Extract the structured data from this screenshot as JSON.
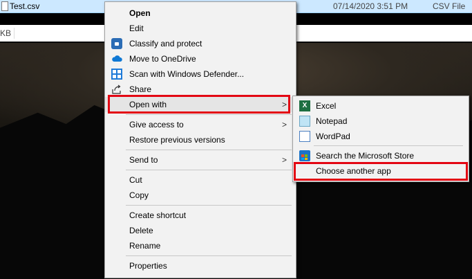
{
  "explorer": {
    "file_name": "Test.csv",
    "file_date": "07/14/2020 3:51 PM",
    "file_type": "CSV File",
    "row2_fragment": "KB"
  },
  "context_menu": {
    "items": [
      {
        "label": "Open"
      },
      {
        "label": "Edit"
      },
      {
        "label": "Classify and protect",
        "icon": "lock-icon"
      },
      {
        "label": "Move to OneDrive",
        "icon": "onedrive-icon"
      },
      {
        "label": "Scan with Windows Defender...",
        "icon": "defender-icon"
      },
      {
        "label": "Share",
        "icon": "share-icon"
      },
      {
        "label": "Open with",
        "submenu": true
      },
      {
        "label": "Give access to",
        "submenu": true
      },
      {
        "label": "Restore previous versions"
      },
      {
        "label": "Send to",
        "submenu": true
      },
      {
        "label": "Cut"
      },
      {
        "label": "Copy"
      },
      {
        "label": "Create shortcut"
      },
      {
        "label": "Delete"
      },
      {
        "label": "Rename"
      },
      {
        "label": "Properties"
      }
    ]
  },
  "open_with_submenu": {
    "items": [
      {
        "label": "Excel",
        "icon": "excel-icon"
      },
      {
        "label": "Notepad",
        "icon": "notepad-icon"
      },
      {
        "label": "WordPad",
        "icon": "wordpad-icon"
      },
      {
        "label": "Search the Microsoft Store",
        "icon": "store-icon"
      },
      {
        "label": "Choose another app"
      }
    ]
  },
  "colors": {
    "highlight_box": "#e30613",
    "selection_row": "#cce8ff"
  }
}
